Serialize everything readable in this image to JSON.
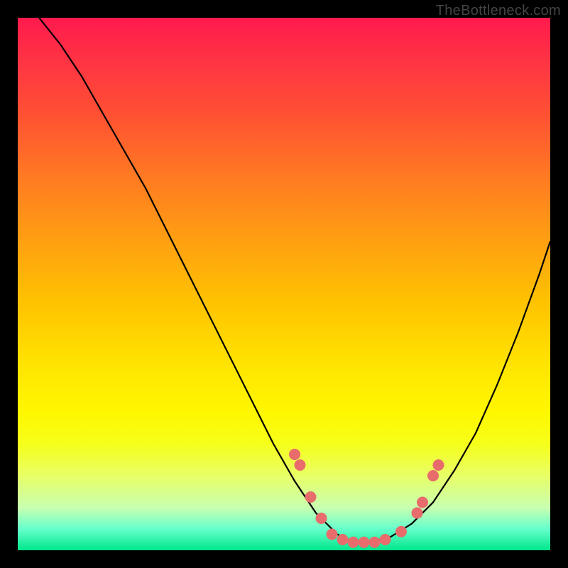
{
  "attribution": "TheBottleneck.com",
  "chart_data": {
    "type": "line",
    "title": "",
    "xlabel": "",
    "ylabel": "",
    "xlim": [
      0,
      100
    ],
    "ylim": [
      0,
      100
    ],
    "series": [
      {
        "name": "curve",
        "x": [
          4,
          8,
          12,
          16,
          20,
          24,
          28,
          32,
          36,
          40,
          44,
          48,
          52,
          56,
          58,
          60,
          62,
          64,
          66,
          70,
          74,
          78,
          82,
          86,
          90,
          94,
          98,
          100
        ],
        "y": [
          100,
          95,
          89,
          82,
          75,
          68,
          60,
          52,
          44,
          36,
          28,
          20,
          13,
          7,
          5,
          3,
          2,
          1.5,
          1.5,
          2.5,
          5,
          9,
          15,
          22,
          31,
          41,
          52,
          58
        ]
      }
    ],
    "markers": {
      "name": "dots",
      "x": [
        52,
        53,
        55,
        57,
        59,
        61,
        63,
        65,
        67,
        69,
        72,
        75,
        76,
        78,
        79
      ],
      "y": [
        18,
        16,
        10,
        6,
        3,
        2,
        1.5,
        1.5,
        1.5,
        2,
        3.5,
        7,
        9,
        14,
        16
      ]
    },
    "colors": {
      "curve": "#000000",
      "markers": "#e86c6c",
      "background_top": "#ff1a4d",
      "background_bottom": "#00e68a"
    }
  }
}
